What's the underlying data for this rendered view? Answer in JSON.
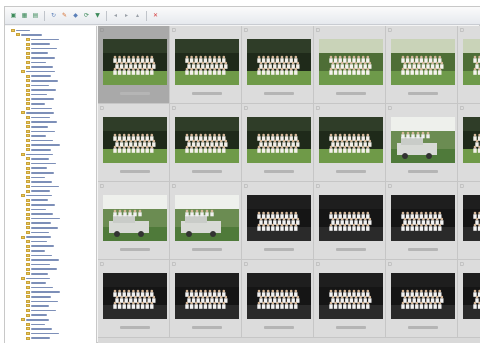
{
  "toolbar": {
    "buttons": [
      {
        "icon": "view-icon",
        "color": "#3d8a5a"
      },
      {
        "icon": "grid-icon",
        "color": "#3d8a5a"
      },
      {
        "icon": "list-icon",
        "color": "#3d8a5a"
      },
      {
        "icon": "rotate-icon",
        "color": "#5a7fb8"
      },
      {
        "icon": "edit-icon",
        "color": "#d46a2a"
      },
      {
        "icon": "tag-icon",
        "color": "#5a7fb8"
      },
      {
        "icon": "refresh-icon",
        "color": "#3d8a5a"
      },
      {
        "icon": "filter-icon",
        "color": "#3d8a5a"
      },
      {
        "icon": "nav-back-icon",
        "color": "#9aa0a8"
      },
      {
        "icon": "nav-forward-icon",
        "color": "#9aa0a8"
      },
      {
        "icon": "nav-up-icon",
        "color": "#9aa0a8"
      },
      {
        "icon": "delete-icon",
        "color": "#d43a3a"
      }
    ]
  },
  "tree": {
    "folder_color": "#e9c95a",
    "label_color": "#7d8fb8"
  },
  "grid": {
    "columns": 6,
    "rows": 4,
    "selected_index": 0,
    "thumbnails": [
      {
        "scene": "group-lawn"
      },
      {
        "scene": "group-lawn"
      },
      {
        "scene": "group-lawn"
      },
      {
        "scene": "group-lawn-bright"
      },
      {
        "scene": "group-lawn-bright"
      },
      {
        "scene": "group-lawn-bright"
      },
      {
        "scene": "group-lawn"
      },
      {
        "scene": "group-lawn"
      },
      {
        "scene": "group-lawn"
      },
      {
        "scene": "group-lawn"
      },
      {
        "scene": "truck-lawn"
      },
      {
        "scene": "group-lawn"
      },
      {
        "scene": "truck-lawn"
      },
      {
        "scene": "truck-lawn"
      },
      {
        "scene": "group-dark"
      },
      {
        "scene": "group-dark"
      },
      {
        "scene": "group-dark"
      },
      {
        "scene": "group-dark"
      },
      {
        "scene": "group-dark"
      },
      {
        "scene": "group-dark"
      },
      {
        "scene": "group-dark"
      },
      {
        "scene": "group-dark"
      },
      {
        "scene": "group-dark"
      },
      {
        "scene": "group-dark"
      }
    ]
  }
}
